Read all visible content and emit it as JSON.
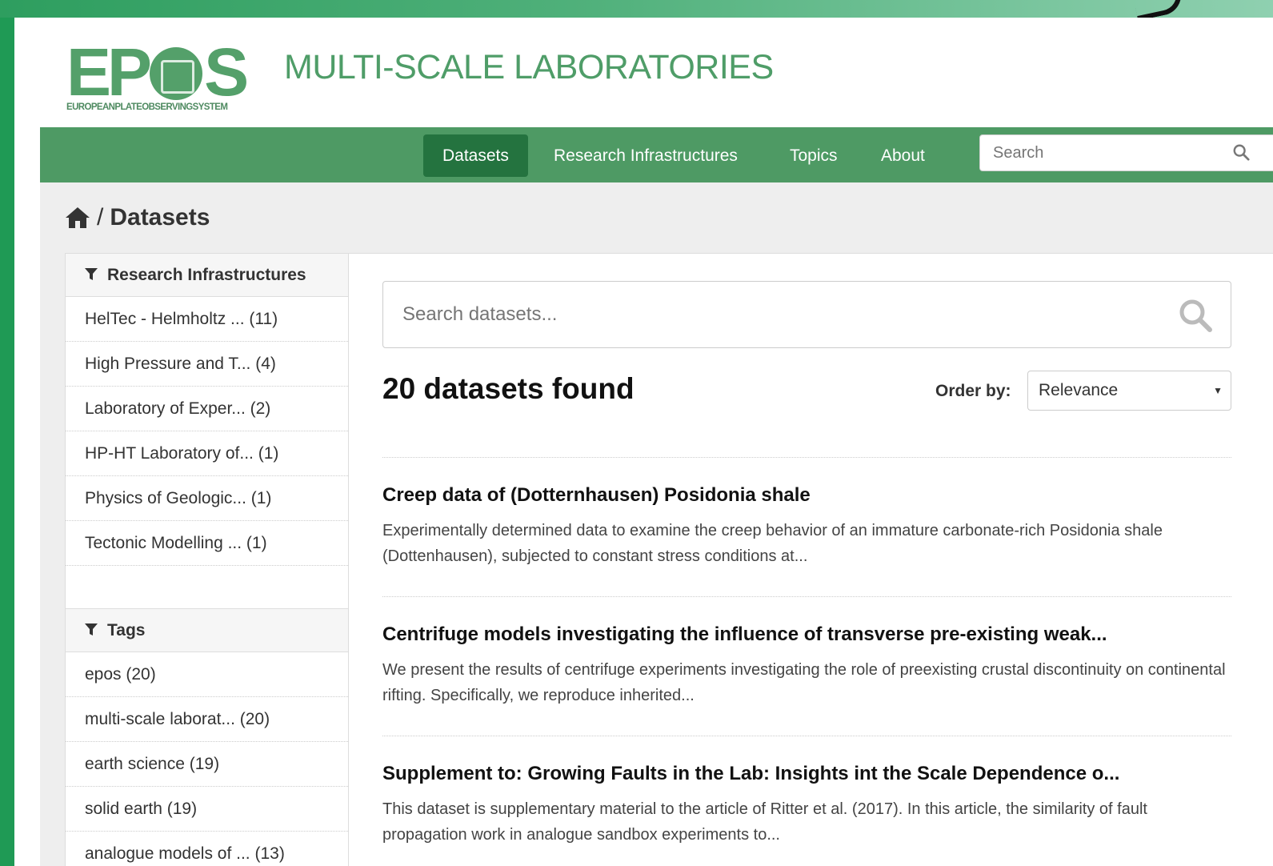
{
  "brand": {
    "logo_word": "EP",
    "logo_word_end": "S",
    "logo_subtitle": "EUROPEANPLATEOBSERVINGSYSTEM",
    "site_title": "MULTI-SCALE LABORATORIES"
  },
  "nav": {
    "items": [
      "Datasets",
      "Research Infrastructures",
      "Topics",
      "About"
    ],
    "active": "Datasets",
    "search_placeholder": "Search"
  },
  "breadcrumb": {
    "separator": "/",
    "current": "Datasets"
  },
  "facets": {
    "research_infrastructures": {
      "title": "Research Infrastructures",
      "items": [
        "HelTec - Helmholtz ... (11)",
        "High Pressure and T... (4)",
        "Laboratory of Exper... (2)",
        "HP-HT Laboratory of... (1)",
        "Physics of Geologic... (1)",
        "Tectonic Modelling ... (1)"
      ]
    },
    "tags": {
      "title": "Tags",
      "items": [
        "epos (20)",
        "multi-scale laborat... (20)",
        "earth science (19)",
        "solid earth (19)",
        "analogue models of ... (13)"
      ]
    }
  },
  "search": {
    "placeholder": "Search datasets...",
    "results_count": "20 datasets found",
    "order_label": "Order by:",
    "order_value": "Relevance"
  },
  "datasets": [
    {
      "title": "Creep data of (Dotternhausen) Posidonia shale",
      "notes": "Experimentally determined data to examine the creep behavior of an immature carbonate-rich Posidonia shale (Dottenhausen), subjected to constant stress conditions at..."
    },
    {
      "title": "Centrifuge models investigating the influence of transverse pre-existing weak...",
      "notes": "We present the results of centrifuge experiments investigating the role of preexisting crustal discontinuity on continental rifting. Specifically, we reproduce inherited..."
    },
    {
      "title": "Supplement to: Growing Faults in the Lab: Insights int the Scale Dependence o...",
      "notes": "This dataset is supplementary material to the article of Ritter et al. (2017). In this article, the similarity of fault propagation work in analogue sandbox experiments to..."
    }
  ],
  "colors": {
    "nav_bg": "#4e9a64",
    "nav_active": "#24733f",
    "brand_green": "#54a06a"
  }
}
